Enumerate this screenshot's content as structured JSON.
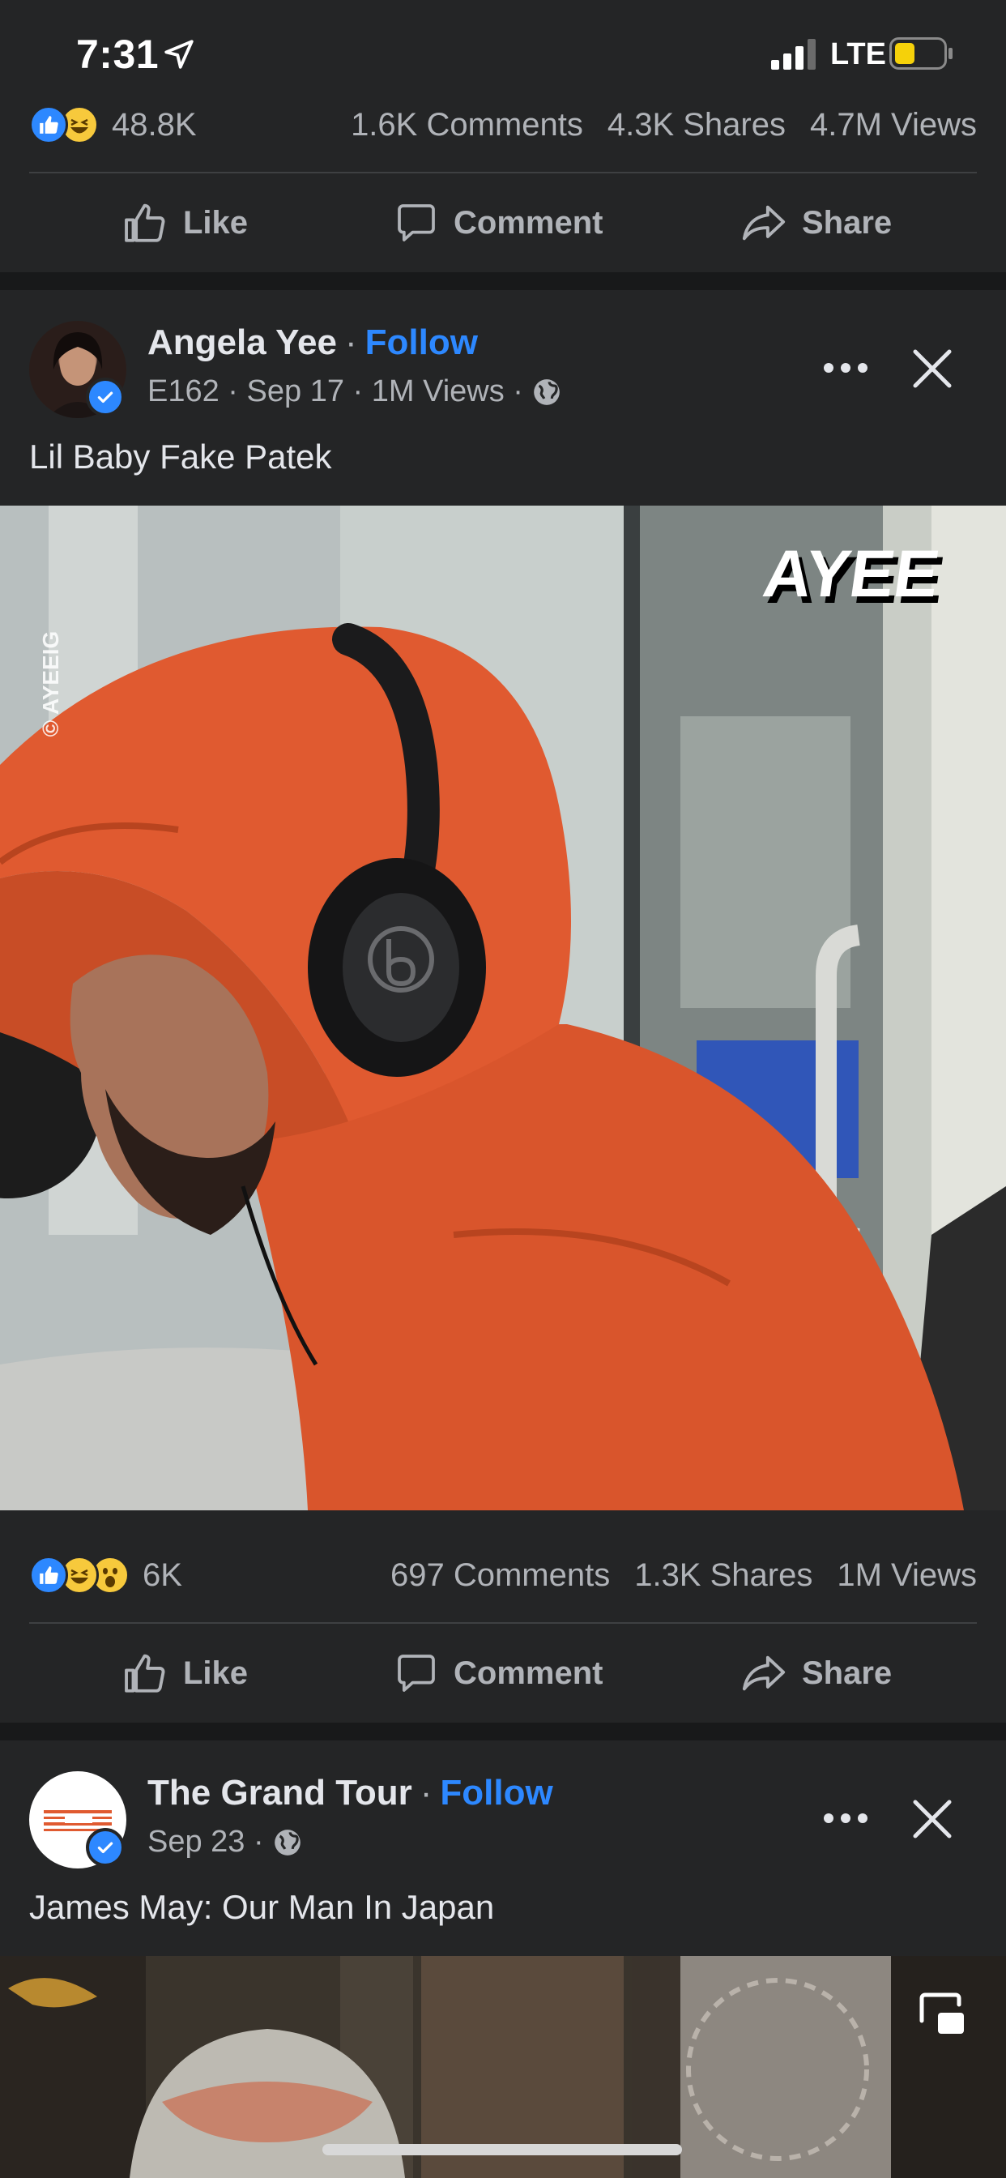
{
  "status_bar": {
    "time": "7:31",
    "carrier": "LTE"
  },
  "post_top": {
    "stats": {
      "reactions": "48.8K",
      "comments": "1.6K Comments",
      "shares": "4.3K Shares",
      "views": "4.7M Views"
    }
  },
  "actions": {
    "like": "Like",
    "comment": "Comment",
    "share": "Share"
  },
  "post1": {
    "author": "Angela Yee",
    "follow": "Follow",
    "meta": "E162 · Sep 17 · 1M Views ·",
    "title": "Lil Baby Fake Patek",
    "watermark": "© AYEEIG",
    "logo_text": "AYEE",
    "stats": {
      "reactions": "6K",
      "comments": "697 Comments",
      "shares": "1.3K Shares",
      "views": "1M Views"
    }
  },
  "post2": {
    "author": "The Grand Tour",
    "follow": "Follow",
    "meta": "Sep 23 ·",
    "title": "James May: Our Man In Japan"
  },
  "icons": {
    "location": "location-arrow-icon",
    "signal": "cellular-signal-icon",
    "battery": "battery-icon",
    "like": "thumbs-up-icon",
    "comment": "comment-bubble-icon",
    "share": "share-arrow-icon",
    "globe": "globe-icon",
    "more": "more-dots-icon",
    "close": "close-icon",
    "pip": "picture-in-picture-icon"
  },
  "colors": {
    "background": "#242526",
    "separator": "#18191a",
    "accent": "#2d88ff",
    "text": "#e4e6eb",
    "secondary": "#b0b3b8",
    "hoodie": "#e0582f"
  }
}
